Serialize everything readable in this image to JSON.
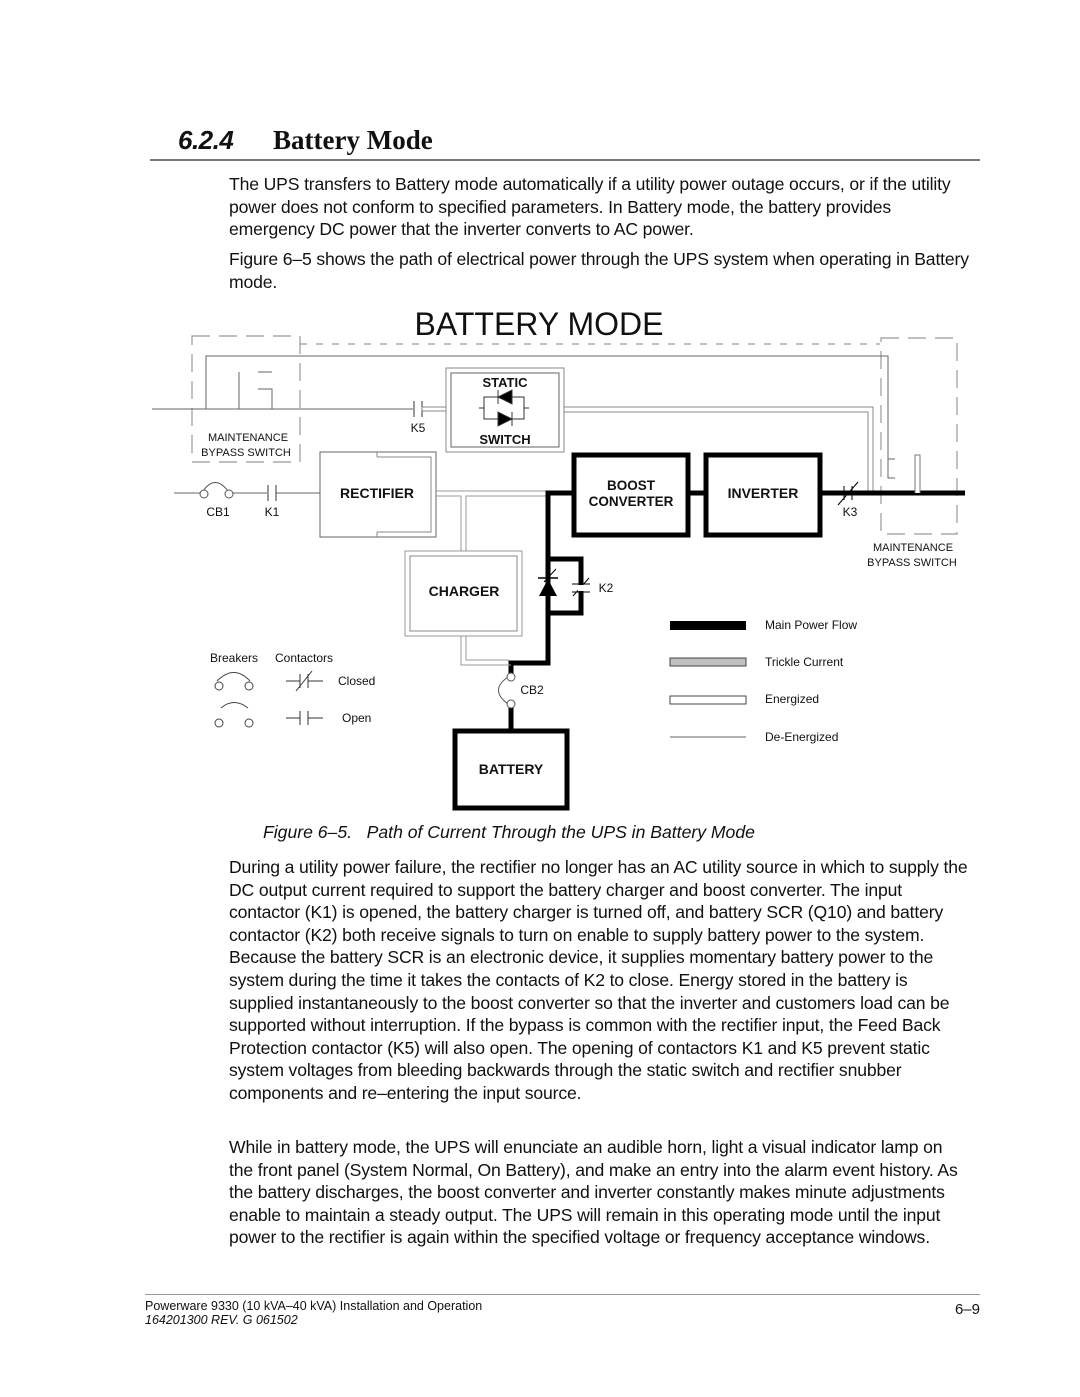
{
  "section": {
    "number": "6.2.4",
    "title": "Battery Mode"
  },
  "paragraphs": [
    "The UPS transfers to Battery mode automatically if a utility power outage occurs, or if the utility power does not conform to specified parameters.  In Battery mode, the battery provides emergency DC power that the inverter converts to AC power.",
    "Figure 6–5 shows the path of electrical power through the UPS system when operating in Battery mode.",
    "During a utility power failure, the rectifier no longer has an AC utility source in which to supply the DC output current required to support the battery charger and boost converter. The input contactor (K1) is opened, the battery charger is turned off, and battery SCR (Q10) and battery contactor (K2) both receive signals to turn on enable to supply battery power to the system.  Because the battery SCR is an electronic device, it supplies momentary battery power to the system during the time it takes the contacts of K2 to close. Energy stored in the battery is supplied instantaneously to the boost converter so that the inverter and customers load can be supported without interruption. If the bypass is common with the rectifier input, the Feed Back Protection contactor (K5) will also open.  The opening of contactors K1 and K5 prevent static system voltages from bleeding backwards through the static switch and rectifier snubber components and re–entering the input source.",
    "While in battery mode, the UPS will enunciate an audible horn, light a visual indicator lamp on the front panel (System Normal, On Battery), and make an entry into the alarm event history.  As the battery discharges, the boost converter and inverter constantly makes minute adjustments enable to maintain a steady output. The UPS will remain in this operating mode until the input power to the rectifier is again within the specified voltage or frequency acceptance windows."
  ],
  "diagram": {
    "title": "BATTERY MODE",
    "blocks": {
      "static_switch": [
        "STATIC",
        "SWITCH"
      ],
      "rectifier": "RECTIFIER",
      "boost_converter": [
        "BOOST",
        "CONVERTER"
      ],
      "inverter": "INVERTER",
      "charger": "CHARGER",
      "battery": "BATTERY"
    },
    "labels": {
      "maintenance_bypass_left": [
        "MAINTENANCE",
        "BYPASS SWITCH"
      ],
      "maintenance_bypass_right": [
        "MAINTENANCE",
        "BYPASS SWITCH"
      ],
      "cb1": "CB1",
      "k1": "K1",
      "k5": "K5",
      "k3": "K3",
      "k2": "K2",
      "cb2": "CB2"
    },
    "symbol_key": {
      "breakers_heading": "Breakers",
      "contactors_heading": "Contactors",
      "closed": "Closed",
      "open": "Open"
    },
    "line_legend": [
      {
        "label": "Main Power Flow",
        "style": "main"
      },
      {
        "label": "Trickle Current",
        "style": "trickle"
      },
      {
        "label": "Energized",
        "style": "energized"
      },
      {
        "label": "De-Energized",
        "style": "deenergized"
      }
    ],
    "colors": {
      "main_flow": "#000000",
      "trickle": "#c0c0c0",
      "energized_outline": "#888888",
      "deenergized": "#666666",
      "dashed": "#999999"
    }
  },
  "figure_caption": "Figure 6–5.   Path of Current Through the UPS in Battery Mode",
  "footer": {
    "title": "Powerware 9330 (10 kVA–40 kVA) Installation and Operation",
    "revision": "164201300 REV. G  061502",
    "page": "6–9"
  }
}
